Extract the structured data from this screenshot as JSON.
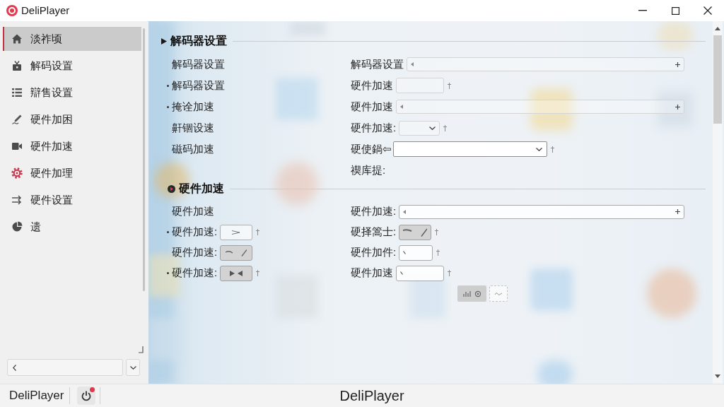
{
  "window": {
    "title": "DeliPlayer"
  },
  "sidebar": {
    "items": [
      {
        "label": "淡祚顷",
        "selected": true
      },
      {
        "label": "解码设置",
        "selected": false
      },
      {
        "label": "辯售设置",
        "selected": false
      },
      {
        "label": "硬件加困",
        "selected": false
      },
      {
        "label": "硬件加速",
        "selected": false
      },
      {
        "label": "硬件加理",
        "selected": false
      },
      {
        "label": "硬件设置",
        "selected": false
      },
      {
        "label": "遗",
        "selected": false
      }
    ]
  },
  "sections": [
    {
      "title": "解码器设置",
      "kind": "arrow",
      "left_rows": [
        {
          "label": "解码器设置",
          "bullet": false,
          "marked": false
        },
        {
          "label": "解码器设置",
          "bullet": true,
          "marked": false
        },
        {
          "label": "掩诠加速",
          "bullet": true,
          "marked": false
        },
        {
          "label": "鼾锢设速",
          "bullet": false,
          "marked": false
        },
        {
          "label": "磁码加速",
          "bullet": false,
          "marked": false
        }
      ],
      "right_rows": [
        {
          "label": "解码器设置",
          "control": {
            "kind": "spin_wide",
            "disabled": true
          },
          "marked": false
        },
        {
          "label": "硬件加速",
          "control": {
            "kind": "field_medium",
            "disabled": true,
            "caret": false
          },
          "marked": true
        },
        {
          "label": "硬件加速",
          "control": {
            "kind": "spin_wide",
            "disabled": true
          },
          "marked": false
        },
        {
          "label": "硬件加速:",
          "control": {
            "kind": "select_small",
            "disabled": true
          },
          "marked": true
        },
        {
          "label": "硬使鍋⇦",
          "control": {
            "kind": "select",
            "disabled": false
          },
          "marked": true
        },
        {
          "label": "禊库提:",
          "marked": false
        }
      ]
    },
    {
      "title": "硬件加速",
      "kind": "disc",
      "left_rows": [
        {
          "label": "硬件加速",
          "bullet": false,
          "marked": false
        },
        {
          "label": "硬件加速:",
          "bullet": true,
          "control": {
            "kind": "arrow_button",
            "pressed": false
          },
          "marked": true
        },
        {
          "label": "硬件加速:",
          "bullet": false,
          "control": {
            "kind": "curve_button",
            "pressed": true
          },
          "marked": false
        },
        {
          "label": "硬件加速:",
          "bullet": true,
          "control": {
            "kind": "bowtie_button",
            "pressed": true
          },
          "marked": true
        }
      ],
      "right_rows": [
        {
          "label": "硬件加速:",
          "control": {
            "kind": "spin_wide",
            "disabled": false
          },
          "marked": false
        },
        {
          "label": "硬择篙士:",
          "control": {
            "kind": "stroke_button",
            "pressed": true
          },
          "marked": true
        },
        {
          "label": "硬件加件:",
          "control": {
            "kind": "field_short",
            "disabled": false,
            "caret": true
          },
          "marked": true
        },
        {
          "label": "硬件加速",
          "control": {
            "kind": "field_medium",
            "disabled": false,
            "caret": true
          },
          "marked": true
        }
      ],
      "tool_buttons": [
        {
          "kind": "solid"
        },
        {
          "kind": "dashed"
        }
      ]
    }
  ],
  "status_bar": {
    "app_label": "DeliPlayer",
    "power_badge": true,
    "title": "DeliPlayer"
  }
}
